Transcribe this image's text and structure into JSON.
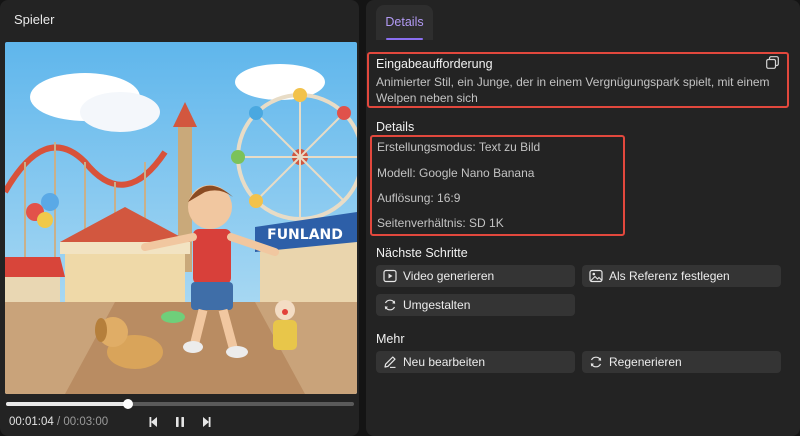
{
  "player": {
    "title": "Spieler",
    "preview_text": {
      "sign": "FUNLAND"
    },
    "progress": 0.35,
    "current_time": "00:01:04",
    "separator": " / ",
    "total_time": "00:03:00"
  },
  "details_panel": {
    "tab": "Details",
    "prompt_heading": "Eingabeaufforderung",
    "prompt_line1": "Animierter Stil, ein Junge, der in einem Vergnügungspark spielt, mit einem",
    "prompt_line2": "Welpen neben sich",
    "details_heading": "Details",
    "details": [
      "Erstellungsmodus: Text zu Bild",
      "Modell: Google Nano Banana",
      "Auflösung: 16:9",
      "Seitenverhältnis: SD 1K"
    ],
    "next_steps_heading": "Nächste Schritte",
    "next_steps": [
      {
        "label": "Video generieren",
        "icon": "play-video-icon"
      },
      {
        "label": "Als Referenz festlegen",
        "icon": "image-reference-icon"
      },
      {
        "label": "Umgestalten",
        "icon": "refresh-icon"
      }
    ],
    "more_heading": "Mehr",
    "more": [
      {
        "label": "Neu bearbeiten",
        "icon": "pencil-icon"
      },
      {
        "label": "Regenerieren",
        "icon": "refresh-icon"
      }
    ]
  },
  "colors": {
    "accent": "#8a6ff0",
    "highlight_box": "#e2483d",
    "panel_bg": "#232323",
    "button_bg": "#343434"
  }
}
